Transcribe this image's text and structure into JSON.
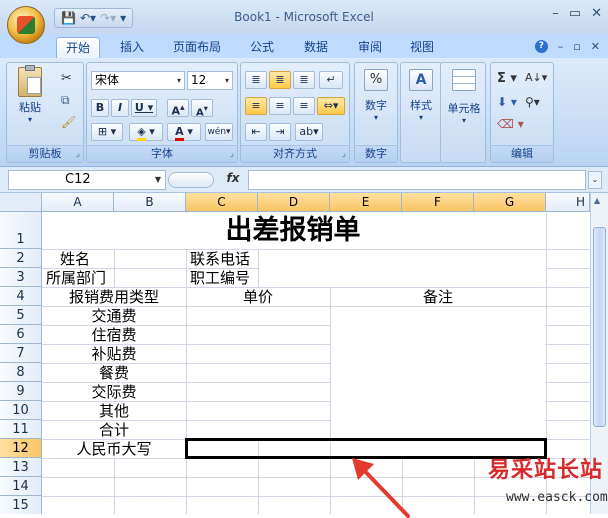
{
  "window": {
    "title": "Book1 - Microsoft Excel",
    "controls": [
      "–",
      "▭",
      "✕"
    ]
  },
  "quick_access": {
    "items": [
      "save-icon",
      "undo-icon",
      "redo-icon"
    ]
  },
  "ribbon": {
    "tabs": [
      "开始",
      "插入",
      "页面布局",
      "公式",
      "数据",
      "审阅",
      "视图"
    ],
    "active_tab": "开始",
    "groups": {
      "clipboard": {
        "label": "剪贴板",
        "paste_label": "粘贴"
      },
      "font": {
        "label": "字体",
        "font_name": "宋体",
        "font_size": "12"
      },
      "alignment": {
        "label": "对齐方式"
      },
      "number": {
        "label": "数字",
        "button": "数字"
      },
      "styles": {
        "label": "样式",
        "button": "样式"
      },
      "cells": {
        "label": "单元格",
        "button": "单元格"
      },
      "editing": {
        "label": "编辑"
      }
    }
  },
  "formula_bar": {
    "name_box": "C12",
    "fx": "fx",
    "content": ""
  },
  "sheet": {
    "columns": [
      "A",
      "B",
      "C",
      "D",
      "E",
      "F",
      "G",
      "H"
    ],
    "selected_column": "C",
    "rows": [
      "1",
      "2",
      "3",
      "4",
      "5",
      "6",
      "7",
      "8",
      "9",
      "10",
      "11",
      "12",
      "13",
      "14",
      "15"
    ],
    "selected_row": "12",
    "title": "出差报销单",
    "cells": {
      "A2": "姓名",
      "C2": "联系电话",
      "A3": "所属部门",
      "C3": "职工编号",
      "A4": "报销费用类型",
      "C4": "单价",
      "E4": "备注",
      "A5": "交通费",
      "A6": "住宿费",
      "A7": "补贴费",
      "A8": "餐费",
      "A9": "交际费",
      "A10": "其他",
      "A11": "合计",
      "A12": "人民币大写"
    }
  },
  "watermark": {
    "text": "易采站长站",
    "url": "www.easck.com"
  }
}
